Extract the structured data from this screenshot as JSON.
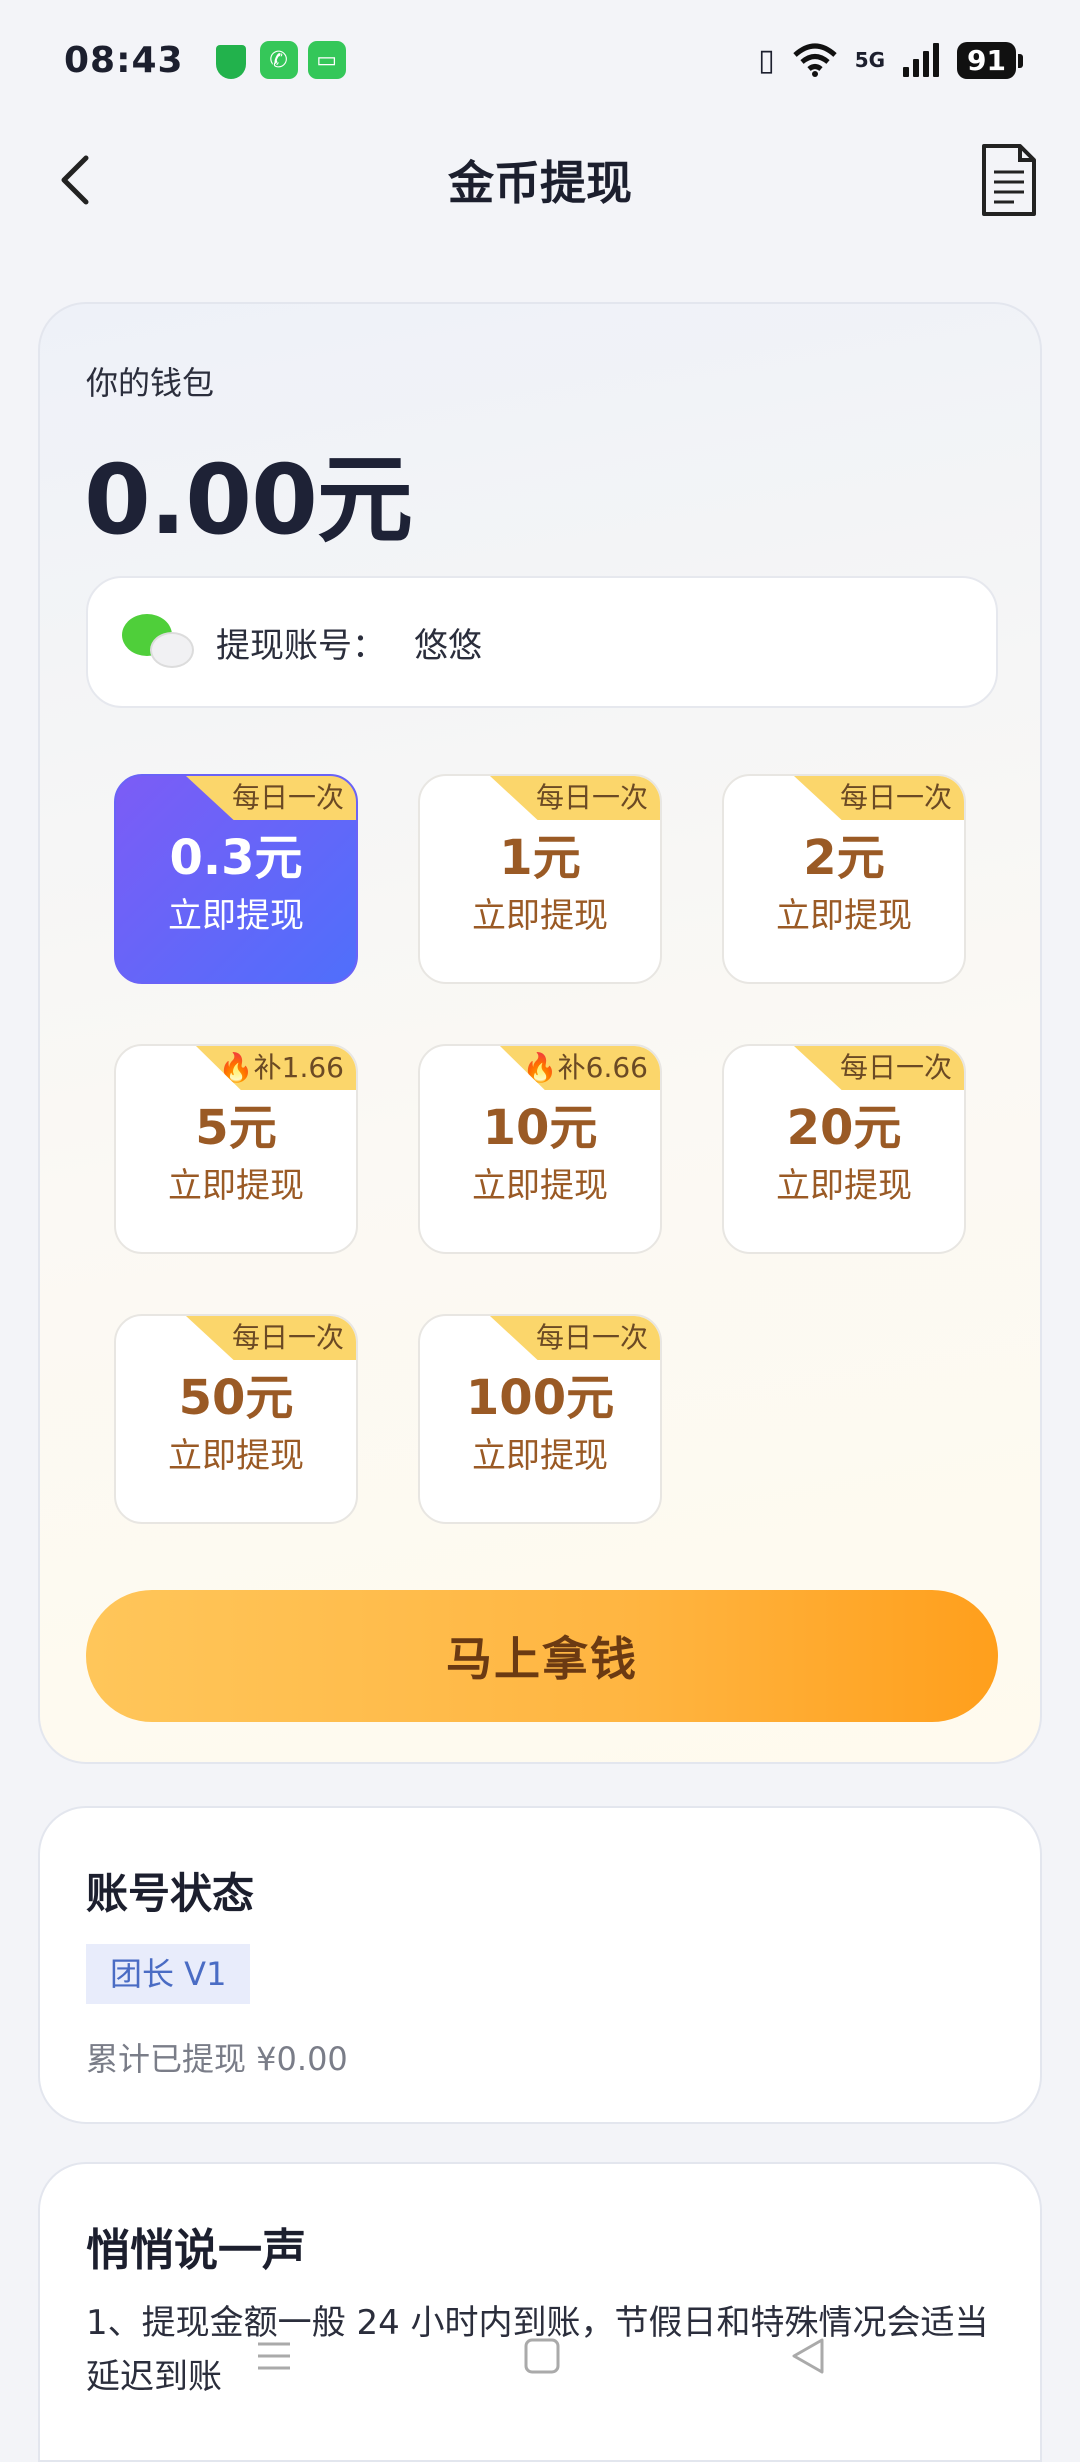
{
  "status_bar": {
    "time": "08:43",
    "network": "5G",
    "battery": "91",
    "icons": [
      "shield-icon",
      "phone-icon",
      "message-icon",
      "vibrate-icon",
      "wifi-icon",
      "signal-icon"
    ]
  },
  "header": {
    "title": "金币提现",
    "back_icon": "chevron-left-icon",
    "doc_icon": "document-icon"
  },
  "wallet": {
    "label": "你的钱包",
    "balance": "0.00元",
    "account": {
      "label": "提现账号：",
      "name": "悠悠",
      "icon": "wechat-icon"
    }
  },
  "amounts": [
    {
      "amount": "0.3元",
      "action": "立即提现",
      "tag": "每日一次",
      "selected": true
    },
    {
      "amount": "1元",
      "action": "立即提现",
      "tag": "每日一次",
      "selected": false
    },
    {
      "amount": "2元",
      "action": "立即提现",
      "tag": "每日一次",
      "selected": false
    },
    {
      "amount": "5元",
      "action": "立即提现",
      "tag": "🔥补1.66元",
      "selected": false
    },
    {
      "amount": "10元",
      "action": "立即提现",
      "tag": "🔥补6.66元",
      "selected": false
    },
    {
      "amount": "20元",
      "action": "立即提现",
      "tag": "每日一次",
      "selected": false
    },
    {
      "amount": "50元",
      "action": "立即提现",
      "tag": "每日一次",
      "selected": false
    },
    {
      "amount": "100元",
      "action": "立即提现",
      "tag": "每日一次",
      "selected": false
    }
  ],
  "cta": {
    "label": "马上拿钱"
  },
  "account_status": {
    "title": "账号状态",
    "level": "团长 V1",
    "withdrawn": "累计已提现 ¥0.00"
  },
  "tips": {
    "title": "悄悄说一声",
    "text": "1、提现金额一般 24 小时内到账，节假日和特殊情况会适当延迟到账"
  },
  "colors": {
    "accent_orange": "#ffb541",
    "selected_gradient_start": "#7c5cf6",
    "selected_gradient_end": "#4f6ffb",
    "tag_yellow": "#fbd66b",
    "amount_brown": "#9a5a25"
  }
}
